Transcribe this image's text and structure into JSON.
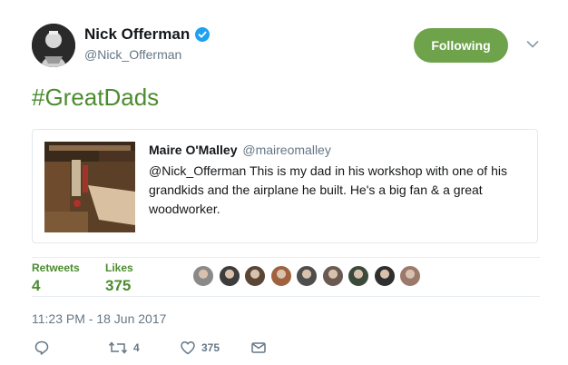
{
  "author": {
    "name": "Nick Offerman",
    "handle": "@Nick_Offerman",
    "verified": true
  },
  "follow_button": {
    "label": "Following"
  },
  "tweet": {
    "text": "#GreatDads"
  },
  "quoted_tweet": {
    "author_name": "Maire O'Malley",
    "author_handle": "@maireomalley",
    "text": "@Nick_Offerman This is my dad in his workshop with one of his grandkids and the airplane he built. He's a big fan & a great woodworker."
  },
  "stats": {
    "retweets_label": "Retweets",
    "retweets": "4",
    "likes_label": "Likes",
    "likes": "375"
  },
  "liker_colors": [
    "#8a8a8a",
    "#3d3d3d",
    "#5a4636",
    "#a0623e",
    "#4e4e4e",
    "#6a5a52",
    "#3b4a3a",
    "#2f2f2f",
    "#9b7a6c"
  ],
  "timestamp": "11:23 PM - 18 Jun 2017",
  "actions": {
    "reply_icon": "reply-icon",
    "retweet_count": "4",
    "like_count": "375",
    "message_icon": "message-icon"
  },
  "colors": {
    "accent": "#4b8c2f",
    "follow_bg": "#6ea34c",
    "verified": "#1da1f2",
    "muted": "#657786"
  }
}
